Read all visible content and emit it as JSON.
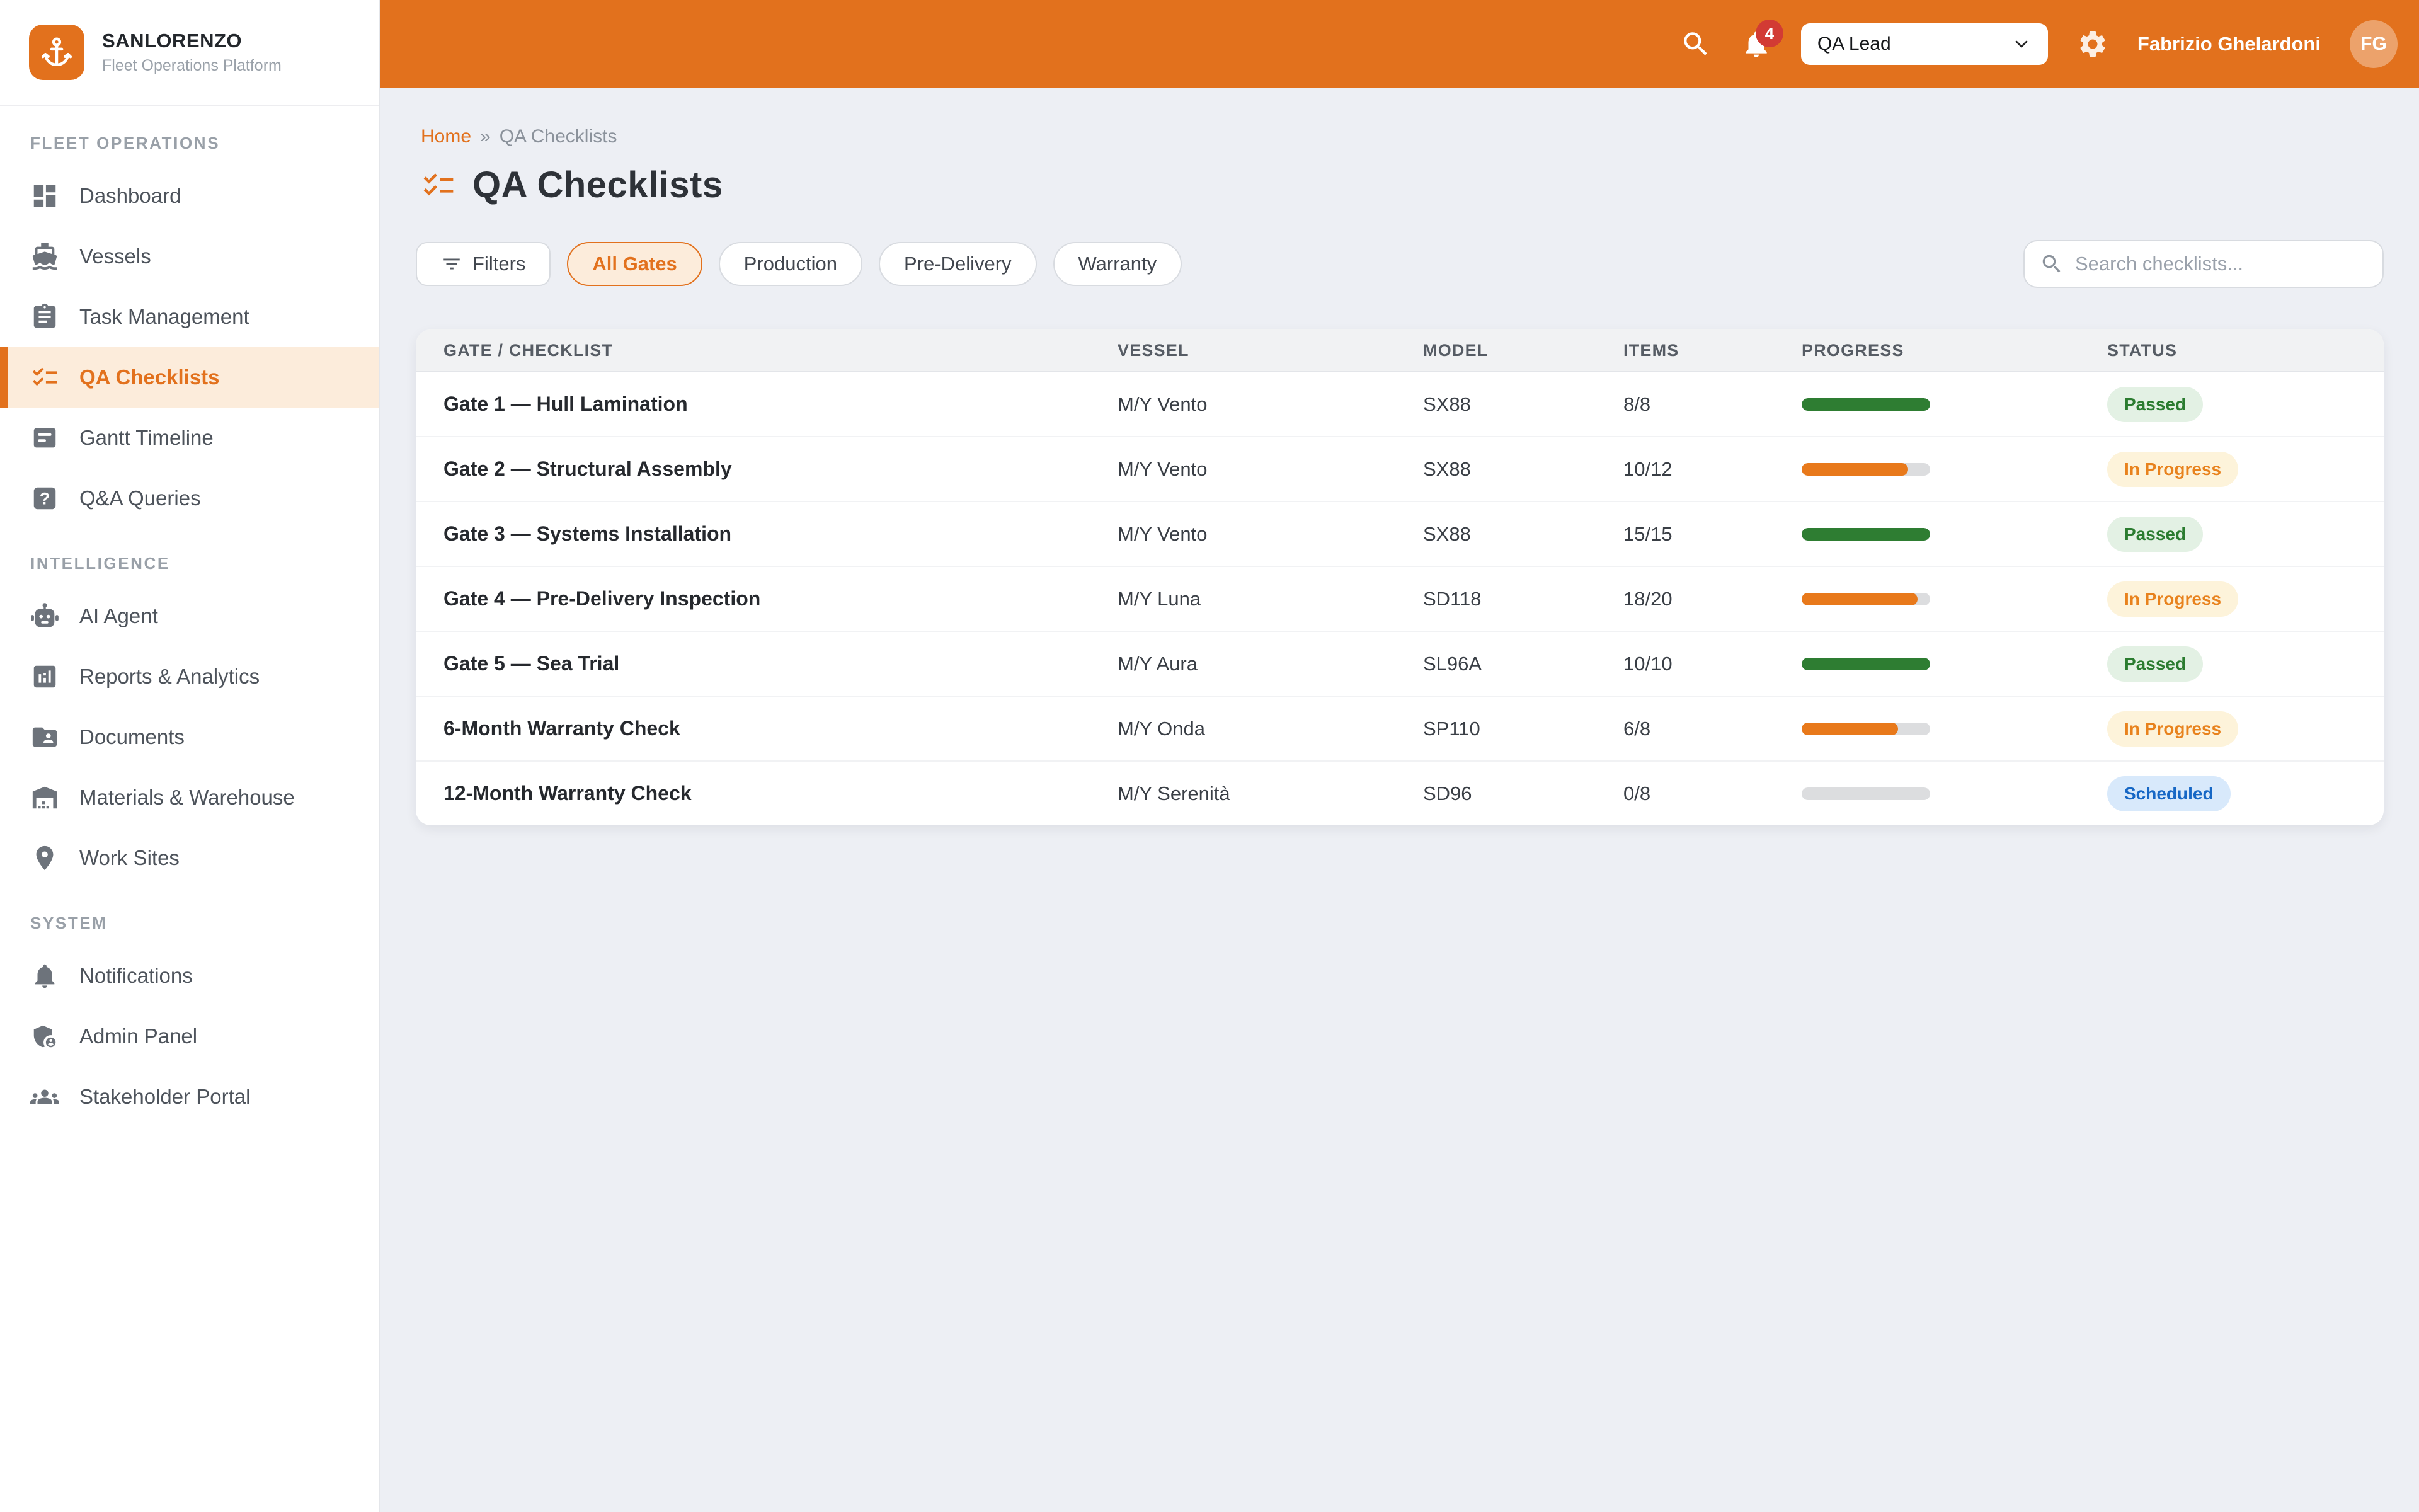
{
  "brand": {
    "name": "SANLORENZO",
    "tagline": "Fleet Operations Platform",
    "logo_icon": "anchor-icon",
    "logo_color": "#E2711D"
  },
  "topbar": {
    "search_icon": "search-icon",
    "bell_icon": "bell-icon",
    "gear_icon": "gear-icon",
    "notification_count": "4",
    "role_select": {
      "value": "QA Lead"
    },
    "user_name": "Fabrizio Ghelardoni",
    "avatar_initials": "FG"
  },
  "sidebar": {
    "sections": [
      {
        "label": "FLEET OPERATIONS",
        "items": [
          {
            "label": "Dashboard",
            "icon": "dashboard-icon",
            "active": false
          },
          {
            "label": "Vessels",
            "icon": "vessel-icon",
            "active": false
          },
          {
            "label": "Task Management",
            "icon": "task-icon",
            "active": false
          },
          {
            "label": "QA Checklists",
            "icon": "checklist-icon",
            "active": true
          },
          {
            "label": "Gantt Timeline",
            "icon": "gantt-icon",
            "active": false
          },
          {
            "label": "Q&A Queries",
            "icon": "qa-icon",
            "active": false
          }
        ]
      },
      {
        "label": "INTELLIGENCE",
        "items": [
          {
            "label": "AI Agent",
            "icon": "robot-icon",
            "active": false
          },
          {
            "label": "Reports & Analytics",
            "icon": "bar-chart-icon",
            "active": false
          },
          {
            "label": "Documents",
            "icon": "folder-icon",
            "active": false
          },
          {
            "label": "Materials & Warehouse",
            "icon": "warehouse-icon",
            "active": false
          },
          {
            "label": "Work Sites",
            "icon": "location-pin-icon",
            "active": false
          }
        ]
      },
      {
        "label": "SYSTEM",
        "items": [
          {
            "label": "Notifications",
            "icon": "bell-icon",
            "active": false
          },
          {
            "label": "Admin Panel",
            "icon": "shield-person-icon",
            "active": false
          },
          {
            "label": "Stakeholder Portal",
            "icon": "people-icon",
            "active": false
          }
        ]
      }
    ]
  },
  "breadcrumb": {
    "home": "Home",
    "separator": "»",
    "current": "QA Checklists"
  },
  "page": {
    "title": "QA Checklists",
    "title_icon": "checklist-icon"
  },
  "toolbar": {
    "filters_button": {
      "label": "Filters",
      "icon": "filter-icon"
    },
    "chips": [
      {
        "label": "All Gates",
        "active": true
      },
      {
        "label": "Production",
        "active": false
      },
      {
        "label": "Pre-Delivery",
        "active": false
      },
      {
        "label": "Warranty",
        "active": false
      }
    ],
    "search": {
      "placeholder": "Search checklists...",
      "icon": "search-icon"
    }
  },
  "table": {
    "columns": [
      "GATE / CHECKLIST",
      "VESSEL",
      "MODEL",
      "ITEMS",
      "PROGRESS",
      "STATUS"
    ],
    "rows": [
      {
        "gate": "Gate 1 — Hull Lamination",
        "vessel": "M/Y Vento",
        "model": "SX88",
        "items": "8/8",
        "progress_pct": 100,
        "status": "Passed",
        "status_type": "passed"
      },
      {
        "gate": "Gate 2 — Structural Assembly",
        "vessel": "M/Y Vento",
        "model": "SX88",
        "items": "10/12",
        "progress_pct": 83,
        "status": "In Progress",
        "status_type": "in-progress"
      },
      {
        "gate": "Gate 3 — Systems Installation",
        "vessel": "M/Y Vento",
        "model": "SX88",
        "items": "15/15",
        "progress_pct": 100,
        "status": "Passed",
        "status_type": "passed"
      },
      {
        "gate": "Gate 4 — Pre-Delivery Inspection",
        "vessel": "M/Y Luna",
        "model": "SD118",
        "items": "18/20",
        "progress_pct": 90,
        "status": "In Progress",
        "status_type": "in-progress"
      },
      {
        "gate": "Gate 5 — Sea Trial",
        "vessel": "M/Y Aura",
        "model": "SL96A",
        "items": "10/10",
        "progress_pct": 100,
        "status": "Passed",
        "status_type": "passed"
      },
      {
        "gate": "6-Month Warranty Check",
        "vessel": "M/Y Onda",
        "model": "SP110",
        "items": "6/8",
        "progress_pct": 75,
        "status": "In Progress",
        "status_type": "in-progress"
      },
      {
        "gate": "12-Month Warranty Check",
        "vessel": "M/Y Serenità",
        "model": "SD96",
        "items": "0/8",
        "progress_pct": 0,
        "status": "Scheduled",
        "status_type": "scheduled"
      }
    ]
  },
  "colors": {
    "primary": "#E2711D",
    "active_item_bg": "#FCECDB",
    "topbar_bg": "#E2711D",
    "page_bg": "#EDEFF4",
    "badge_red": "#D23B34",
    "passed_text": "#2B7C30",
    "passed_bg": "#E3F1E4",
    "in_progress_text": "#E8821D",
    "in_progress_bg": "#FDF3DA",
    "scheduled_text": "#1667C5",
    "scheduled_bg": "#D8E9FB",
    "progress_green": "#2E7D32",
    "progress_orange": "#E8791B",
    "progress_track": "#DCDDDF"
  }
}
